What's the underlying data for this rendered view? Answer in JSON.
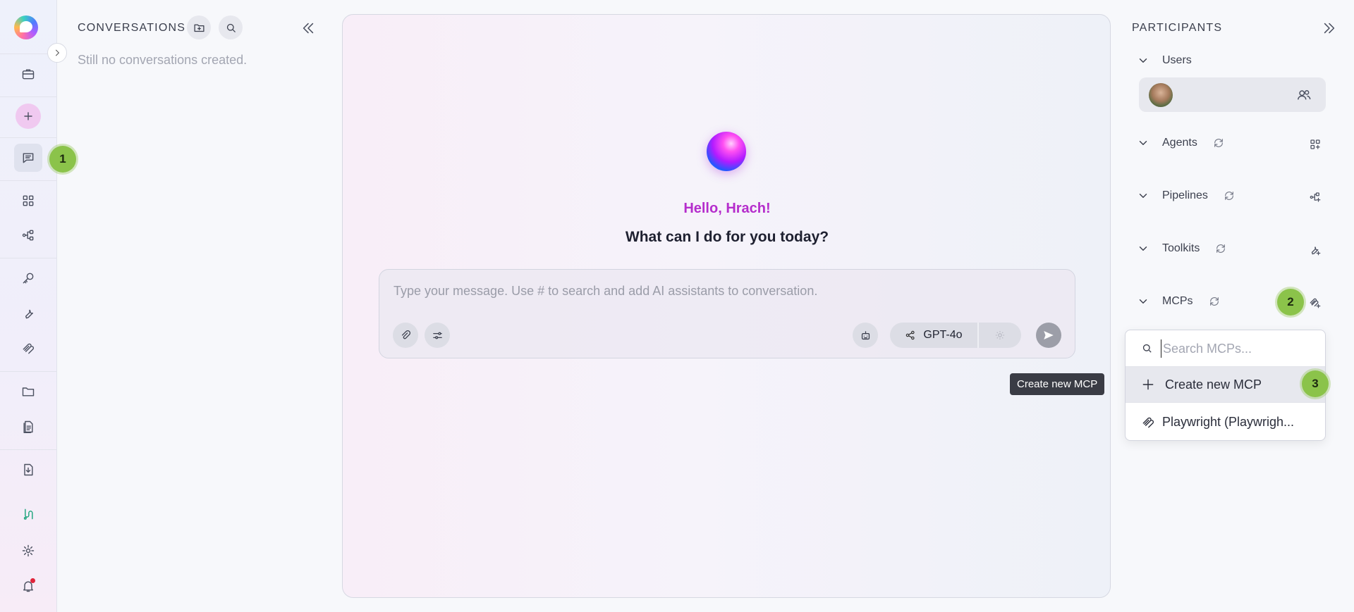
{
  "app": {
    "accent": "#b52dcc",
    "badge_color": "#8bc34a"
  },
  "steps": [
    "1",
    "2",
    "3"
  ],
  "sidebar": {
    "icons": [
      "briefcase-icon",
      "add-icon",
      "chat-icon",
      "apps-grid-icon",
      "pipeline-icon",
      "key-icon",
      "wrench-icon",
      "mcp-icon",
      "folder-icon",
      "documents-icon",
      "download-doc-icon",
      "integration-icon",
      "settings-icon",
      "bell-icon"
    ]
  },
  "conversations": {
    "title": "CONVERSATIONS",
    "empty_text": "Still no conversations created."
  },
  "chat": {
    "greeting": "Hello, Hrach!",
    "subtitle": "What can I do for you today?",
    "input_placeholder": "Type your message. Use # to search and add AI assistants to conversation.",
    "model": "GPT-4o"
  },
  "tooltip": {
    "text": "Create new MCP"
  },
  "participants": {
    "title": "PARTICIPANTS",
    "sections": {
      "users": "Users",
      "agents": "Agents",
      "pipelines": "Pipelines",
      "toolkits": "Toolkits",
      "mcps": "MCPs"
    },
    "mcp_dropdown": {
      "search_placeholder": "Search MCPs...",
      "create_label": "Create new MCP",
      "items": [
        "Playwright (Playwrigh..."
      ]
    }
  }
}
